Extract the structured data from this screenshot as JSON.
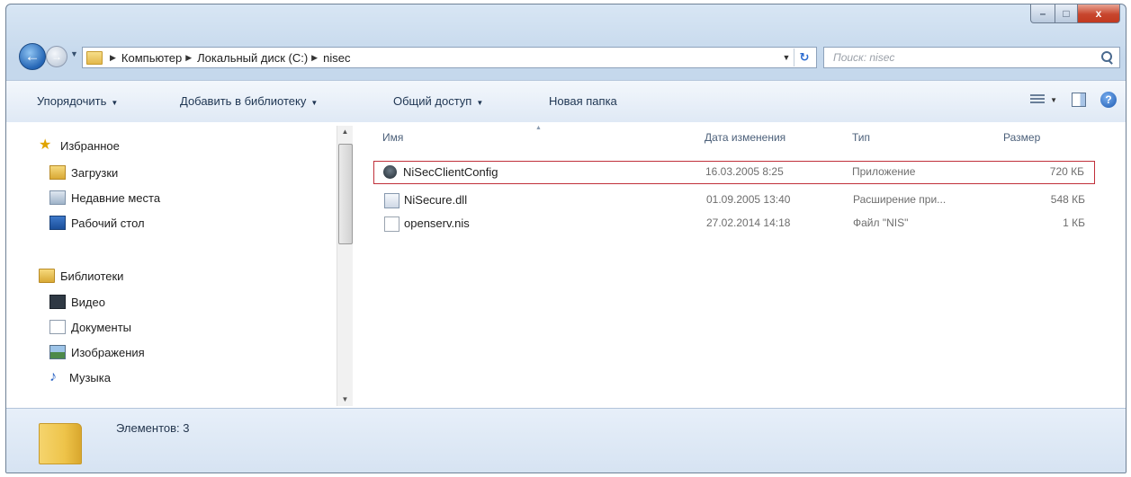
{
  "window": {
    "caption_buttons": {
      "minimize": "–",
      "maximize": "□",
      "close": "x"
    }
  },
  "nav": {
    "back_glyph": "←",
    "forward_glyph": "→"
  },
  "address": {
    "crumbs": [
      "Компьютер",
      "Локальный диск (C:)",
      "nisec"
    ],
    "refresh_glyph": "↻"
  },
  "search": {
    "placeholder": "Поиск: nisec"
  },
  "toolbar": {
    "organize": "Упорядочить",
    "add_to_library": "Добавить в библиотеку",
    "share": "Общий доступ",
    "new_folder": "Новая папка",
    "help_glyph": "?"
  },
  "navpane": {
    "favorites": {
      "title": "Избранное",
      "items": [
        "Загрузки",
        "Недавние места",
        "Рабочий стол"
      ]
    },
    "libraries": {
      "title": "Библиотеки",
      "items": [
        "Видео",
        "Документы",
        "Изображения",
        "Музыка"
      ]
    }
  },
  "files": {
    "columns": {
      "name": "Имя",
      "date": "Дата изменения",
      "type": "Тип",
      "size": "Размер"
    },
    "rows": [
      {
        "name": "NiSecClientConfig",
        "date": "16.03.2005 8:25",
        "type": "Приложение",
        "size": "720 КБ",
        "icon": "app-icon",
        "highlighted": true
      },
      {
        "name": "NiSecure.dll",
        "date": "01.09.2005 13:40",
        "type": "Расширение при...",
        "size": "548 КБ",
        "icon": "dll-icon",
        "highlighted": false
      },
      {
        "name": "openserv.nis",
        "date": "27.02.2014 14:18",
        "type": "Файл \"NIS\"",
        "size": "1 КБ",
        "icon": "file-icon",
        "highlighted": false
      }
    ]
  },
  "status": {
    "text": "Элементов: 3"
  },
  "colors": {
    "highlight_border": "#c0303a",
    "chrome": "#c5d8ec"
  }
}
